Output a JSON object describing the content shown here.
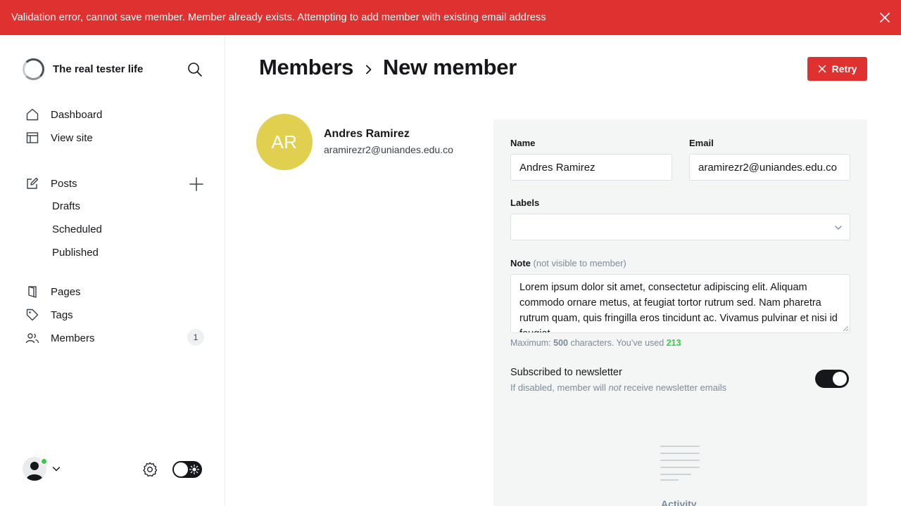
{
  "alert": {
    "message": "Validation error, cannot save member. Member already exists. Attempting to add member with existing email address",
    "close_icon": "close-icon"
  },
  "site": {
    "title": "The real tester life"
  },
  "nav": {
    "dashboard": "Dashboard",
    "view_site": "View site",
    "posts": "Posts",
    "drafts": "Drafts",
    "scheduled": "Scheduled",
    "published": "Published",
    "pages": "Pages",
    "tags": "Tags",
    "members": "Members",
    "members_count": "1"
  },
  "breadcrumb": {
    "parent": "Members",
    "current": "New member"
  },
  "actions": {
    "retry": "Retry"
  },
  "member": {
    "initials": "AR",
    "name": "Andres Ramirez",
    "email": "aramirezr2@uniandes.edu.co"
  },
  "form": {
    "name_label": "Name",
    "name_value": "Andres Ramirez",
    "email_label": "Email",
    "email_value": "aramirezr2@uniandes.edu.co",
    "labels_label": "Labels",
    "labels_value": "",
    "note_label": "Note",
    "note_hint": "(not visible to member)",
    "note_value": "Lorem ipsum dolor sit amet, consectetur adipiscing elit. Aliquam commodo ornare metus, at feugiat tortor rutrum sed. Nam pharetra rutrum quam, quis fringilla eros tincidunt ac. Vivamus pulvinar et nisi id feugiat.",
    "counter_prefix": "Maximum:",
    "counter_max": "500",
    "counter_mid": "characters. You’ve used",
    "counter_used": "213",
    "newsletter_title": "Subscribed to newsletter",
    "newsletter_desc_before": "If disabled, member will",
    "newsletter_desc_em": "not",
    "newsletter_desc_after": "receive newsletter emails",
    "newsletter_enabled": true
  },
  "activity": {
    "label": "Activity"
  },
  "colors": {
    "alert_red": "#e03131",
    "avatar_yellow": "#e1cf4f",
    "online_green": "#30cf43",
    "panel_bg": "#f4f5f5",
    "dark": "#15171a"
  }
}
